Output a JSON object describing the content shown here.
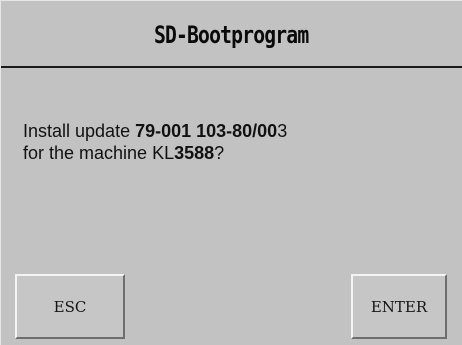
{
  "title": "SD-Bootprogram",
  "message": {
    "line1": {
      "prefix": "Install update ",
      "p1": "79-001 103-80/00",
      "p2": "3"
    },
    "line2": {
      "prefix": "for the machine KL",
      "p1": "3588",
      "p2": "?"
    }
  },
  "buttons": {
    "esc_label": "ESC",
    "enter_label": "ENTER"
  }
}
